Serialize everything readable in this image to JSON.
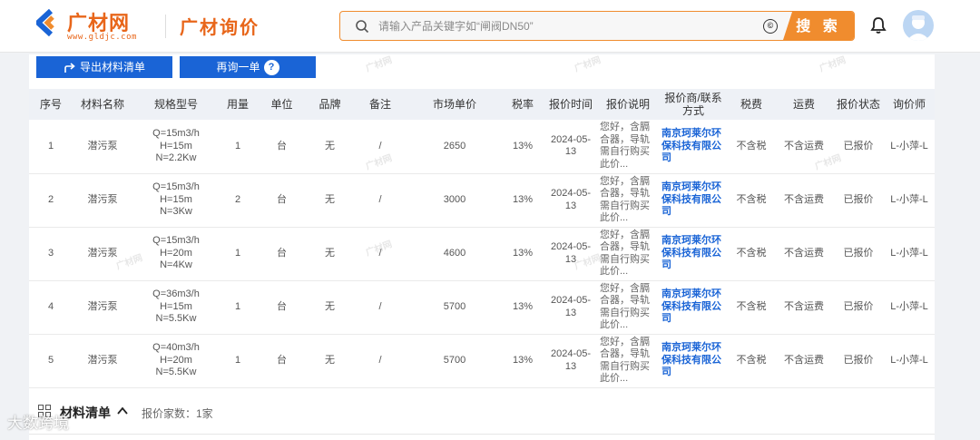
{
  "header": {
    "logo_text": "广材网",
    "logo_url_text": "www.gldjc.com",
    "page_brand": "广材询价",
    "search": {
      "placeholder": "请输入产品关键字如“闸阀DN50”",
      "clear_symbol": "©",
      "button_label": "搜 索"
    }
  },
  "toolbar": {
    "export_label": "导出材料清单",
    "requery_label": "再询一单",
    "help_symbol": "?"
  },
  "table": {
    "columns": [
      "序号",
      "材料名称",
      "规格型号",
      "用量",
      "单位",
      "品牌",
      "备注",
      "市场单价",
      "税率",
      "报价时间",
      "报价说明",
      "报价商/联系方式",
      "税费",
      "运费",
      "报价状态",
      "询价师"
    ],
    "rows": [
      {
        "no": "1",
        "name": "潜污泵",
        "spec": [
          "Q=15m3/h",
          "H=15m",
          "N=2.2Kw"
        ],
        "qty": "1",
        "unit": "台",
        "brand": "无",
        "note": "/",
        "price": "2650",
        "tax_rate": "13%",
        "date": "2024-05-13",
        "desc": "您好，含膈合器，导轨需自行购买此价...",
        "vendor": "南京珂莱尔环保科技有限公司",
        "tax": "不含税",
        "freight": "不含运费",
        "status": "已报价",
        "inquirer": "L-小萍-L"
      },
      {
        "no": "2",
        "name": "潜污泵",
        "spec": [
          "Q=15m3/h",
          "H=15m",
          "N=3Kw"
        ],
        "qty": "2",
        "unit": "台",
        "brand": "无",
        "note": "/",
        "price": "3000",
        "tax_rate": "13%",
        "date": "2024-05-13",
        "desc": "您好，含膈合器，导轨需自行购买此价...",
        "vendor": "南京珂莱尔环保科技有限公司",
        "tax": "不含税",
        "freight": "不含运费",
        "status": "已报价",
        "inquirer": "L-小萍-L"
      },
      {
        "no": "3",
        "name": "潜污泵",
        "spec": [
          "Q=15m3/h",
          "H=20m",
          "N=4Kw"
        ],
        "qty": "1",
        "unit": "台",
        "brand": "无",
        "note": "/",
        "price": "4600",
        "tax_rate": "13%",
        "date": "2024-05-13",
        "desc": "您好，含膈合器，导轨需自行购买此价...",
        "vendor": "南京珂莱尔环保科技有限公司",
        "tax": "不含税",
        "freight": "不含运费",
        "status": "已报价",
        "inquirer": "L-小萍-L"
      },
      {
        "no": "4",
        "name": "潜污泵",
        "spec": [
          "Q=36m3/h",
          "H=15m",
          "N=5.5Kw"
        ],
        "qty": "1",
        "unit": "台",
        "brand": "无",
        "note": "/",
        "price": "5700",
        "tax_rate": "13%",
        "date": "2024-05-13",
        "desc": "您好，含膈合器，导轨需自行购买此价...",
        "vendor": "南京珂莱尔环保科技有限公司",
        "tax": "不含税",
        "freight": "不含运费",
        "status": "已报价",
        "inquirer": "L-小萍-L"
      },
      {
        "no": "5",
        "name": "潜污泵",
        "spec": [
          "Q=40m3/h",
          "H=20m",
          "N=5.5Kw"
        ],
        "qty": "1",
        "unit": "台",
        "brand": "无",
        "note": "/",
        "price": "5700",
        "tax_rate": "13%",
        "date": "2024-05-13",
        "desc": "您好，含膈合器，导轨需自行购买此价...",
        "vendor": "南京珂莱尔环保科技有限公司",
        "tax": "不含税",
        "freight": "不含运费",
        "status": "已报价",
        "inquirer": "L-小萍-L"
      }
    ]
  },
  "bottom": {
    "section_title": "材料清单",
    "vendor_count": "报价家数：1家"
  },
  "watermark": {
    "corner_text": "大数跨境",
    "logo_text": "广材网"
  },
  "colors": {
    "accent_orange": "#f08c2e",
    "primary_blue": "#1a64d6",
    "header_row_bg": "#eef1f6"
  }
}
